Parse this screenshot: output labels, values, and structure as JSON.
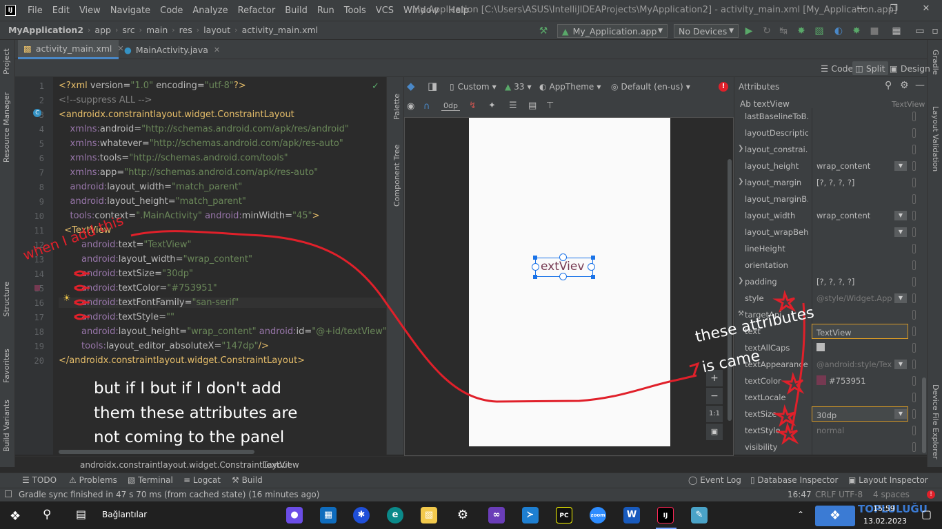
{
  "menubar": {
    "logo": "IJ",
    "items": [
      "File",
      "Edit",
      "View",
      "Navigate",
      "Code",
      "Analyze",
      "Refactor",
      "Build",
      "Run",
      "Tools",
      "VCS",
      "Window",
      "Help"
    ],
    "window_title": "My Application [C:\\Users\\ASUS\\IntelliJIDEAProjects\\MyApplication2] - activity_main.xml [My_Application.app]"
  },
  "navbar": {
    "breadcrumbs": [
      "MyApplication2",
      "app",
      "src",
      "main",
      "res",
      "layout",
      "activity_main.xml"
    ],
    "run_config": "My_Application.app",
    "device": "No Devices"
  },
  "left_strip": {
    "project": "Project",
    "resource_manager": "Resource Manager",
    "structure": "Structure",
    "favorites": "Favorites",
    "build_variants": "Build Variants"
  },
  "right_strip": {
    "gradle": "Gradle",
    "layout_validation": "Layout Validation",
    "device_file_explorer": "Device File Explorer"
  },
  "tabs": [
    {
      "label": "activity_main.xml",
      "icon": "xml-file-icon"
    },
    {
      "label": "MainActivity.java",
      "icon": "java-class-icon"
    }
  ],
  "view_modes": [
    "Code",
    "Split",
    "Design"
  ],
  "design_toolbar": {
    "device": "Custom",
    "api": "33",
    "theme": "AppTheme",
    "locale": "Default (en-us)",
    "margin": "0dp"
  },
  "palette_strip": {
    "palette": "Palette",
    "component_tree": "Component Tree"
  },
  "code_lines": [
    {
      "n": "1",
      "parts": [
        [
          "tag",
          "<?xml "
        ],
        [
          "an",
          "version="
        ],
        [
          "av",
          "\"1.0\" "
        ],
        [
          "an",
          "encoding="
        ],
        [
          "av",
          "\"utf-8\""
        ],
        [
          "tag",
          "?>"
        ]
      ]
    },
    {
      "n": "2",
      "parts": [
        [
          "cm",
          "<!--suppress ALL -->"
        ]
      ]
    },
    {
      "n": "3",
      "parts": [
        [
          "tag",
          "<androidx.constraintlayout.widget.ConstraintLayout"
        ]
      ]
    },
    {
      "n": "4",
      "parts": [
        [
          "ns",
          "    xmlns:"
        ],
        [
          "an",
          "android="
        ],
        [
          "av",
          "\"http://schemas.android.com/apk/res/android\""
        ]
      ]
    },
    {
      "n": "5",
      "parts": [
        [
          "ns",
          "    xmlns:"
        ],
        [
          "an",
          "whatever="
        ],
        [
          "av",
          "\"http://schemas.android.com/apk/res-auto\""
        ]
      ]
    },
    {
      "n": "6",
      "parts": [
        [
          "ns",
          "    xmlns:"
        ],
        [
          "an",
          "tools="
        ],
        [
          "av",
          "\"http://schemas.android.com/tools\""
        ]
      ]
    },
    {
      "n": "7",
      "parts": [
        [
          "ns",
          "    xmlns:"
        ],
        [
          "an",
          "app="
        ],
        [
          "av",
          "\"http://schemas.android.com/apk/res-auto\""
        ]
      ]
    },
    {
      "n": "8",
      "parts": [
        [
          "ns",
          "    android:"
        ],
        [
          "an",
          "layout_width="
        ],
        [
          "av",
          "\"match_parent\""
        ]
      ]
    },
    {
      "n": "9",
      "parts": [
        [
          "ns",
          "    android:"
        ],
        [
          "an",
          "layout_height="
        ],
        [
          "av",
          "\"match_parent\""
        ]
      ]
    },
    {
      "n": "10",
      "parts": [
        [
          "ns",
          "    tools:"
        ],
        [
          "an",
          "context="
        ],
        [
          "av",
          "\".MainActivity\" "
        ],
        [
          "ns",
          "android:"
        ],
        [
          "an",
          "minWidth="
        ],
        [
          "av",
          "\"45\""
        ],
        [
          "tag",
          ">"
        ]
      ]
    },
    {
      "n": "11",
      "parts": [
        [
          "tag",
          "  <TextView"
        ]
      ]
    },
    {
      "n": "12",
      "parts": [
        [
          "ns",
          "        android:"
        ],
        [
          "an",
          "text="
        ],
        [
          "av",
          "\"TextView\""
        ]
      ]
    },
    {
      "n": "13",
      "parts": [
        [
          "ns",
          "        android:"
        ],
        [
          "an",
          "layout_width="
        ],
        [
          "av",
          "\"wrap_content\""
        ]
      ]
    },
    {
      "n": "14",
      "parts": [
        [
          "ns",
          "        android:"
        ],
        [
          "an",
          "textSize="
        ],
        [
          "av",
          "\"30dp\""
        ]
      ]
    },
    {
      "n": "15",
      "parts": [
        [
          "ns",
          "        android:"
        ],
        [
          "an",
          "textColor="
        ],
        [
          "av",
          "\"#753951\""
        ]
      ]
    },
    {
      "n": "16",
      "parts": [
        [
          "ns",
          "        android:"
        ],
        [
          "an",
          "textFontFamily="
        ],
        [
          "av",
          "\"san-serif\""
        ]
      ]
    },
    {
      "n": "17",
      "parts": [
        [
          "ns",
          "        android:"
        ],
        [
          "an",
          "textStyle="
        ],
        [
          "av",
          "\"\""
        ]
      ]
    },
    {
      "n": "18",
      "parts": [
        [
          "ns",
          "        android:"
        ],
        [
          "an",
          "layout_height="
        ],
        [
          "av",
          "\"wrap_content\" "
        ],
        [
          "ns",
          "android:"
        ],
        [
          "an",
          "id="
        ],
        [
          "av",
          "\"@+id/textView\""
        ]
      ]
    },
    {
      "n": "19",
      "parts": [
        [
          "ns",
          "        tools:"
        ],
        [
          "an",
          "layout_editor_absoluteX="
        ],
        [
          "av",
          "\"147dp\""
        ],
        [
          "tag",
          "/>"
        ]
      ]
    },
    {
      "n": "20",
      "parts": [
        [
          "tag",
          "</androidx.constraintlayout.widget.ConstraintLayout>"
        ]
      ]
    }
  ],
  "preview": {
    "text": "extViev"
  },
  "attributes": {
    "title": "Attributes",
    "component_label": "Ab textView",
    "component_type": "TextView",
    "rows": [
      {
        "name": "lastBaselineToB...",
        "value": ""
      },
      {
        "name": "layoutDescription",
        "value": ""
      },
      {
        "name": "layout_constrai...",
        "value": "",
        "expand": true
      },
      {
        "name": "layout_height",
        "value": "wrap_content",
        "dropdown": true
      },
      {
        "name": "layout_margin",
        "value": "[?, ?, ?, ?]",
        "expand": true
      },
      {
        "name": "layout_marginB...",
        "value": ""
      },
      {
        "name": "layout_width",
        "value": "wrap_content",
        "dropdown": true
      },
      {
        "name": "layout_wrapBeh...",
        "value": "",
        "dropdown": true
      },
      {
        "name": "lineHeight",
        "value": ""
      },
      {
        "name": "orientation",
        "value": ""
      },
      {
        "name": "padding",
        "value": "[?, ?, ?, ?]",
        "expand": true
      },
      {
        "name": "style",
        "value": "@style/Widget.App",
        "hint": true,
        "dropdown": true
      },
      {
        "name": "targetApi",
        "value": "",
        "wrench": true
      },
      {
        "name": "text",
        "value": "TextView",
        "boxed": true
      },
      {
        "name": "textAllCaps",
        "value": "",
        "checkbox": true
      },
      {
        "name": "textAppearance",
        "value": "@android:style/Tex",
        "hint": true,
        "dropdown": true
      },
      {
        "name": "textColor",
        "value": "#753951",
        "swatch": "#753951"
      },
      {
        "name": "textLocale",
        "value": ""
      },
      {
        "name": "textSize",
        "value": "30dp",
        "boxed": true,
        "dropdown": true
      },
      {
        "name": "textStyle",
        "value": "normal",
        "hint": true
      },
      {
        "name": "visibility",
        "value": ""
      }
    ]
  },
  "bottom_breadcrumb": [
    "androidx.constraintlayout.widget.ConstraintLayout",
    "TextView"
  ],
  "toolwindows": [
    "TODO",
    "Problems",
    "Terminal",
    "Logcat",
    "Build",
    "Event Log",
    "Database Inspector",
    "Layout Inspector"
  ],
  "status": {
    "message": "Gradle sync finished in 47 s 70 ms (from cached state) (16 minutes ago)",
    "position": "16:47",
    "encoding": "CRLF  UTF-8",
    "indent": "4 spaces"
  },
  "taskbar": {
    "search_label": "Bağlantılar",
    "time": "15:59",
    "date": "13.02.2023",
    "watermark": "TOPLULUĞU"
  },
  "annotations": {
    "when_i_add": "when I add this",
    "these_attributes": "these attributes",
    "is_came": "is came",
    "note_line1": "but if I but if I don't add",
    "note_line2": "them these attributes are",
    "note_line3": "not coming to the panel"
  },
  "colors": {
    "accent": "#4a88c7",
    "text_color_value": "#753951",
    "annotation_red": "#e0202a",
    "selection_blue": "#1a73e8"
  }
}
